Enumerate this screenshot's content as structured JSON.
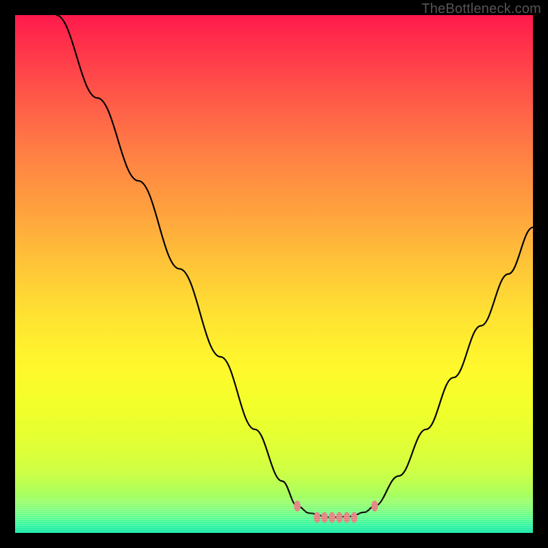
{
  "watermark": "TheBottleneck.com",
  "colors": {
    "curve_stroke": "#000000",
    "marker_stroke": "#e08080"
  },
  "chart_data": {
    "type": "line",
    "title": "",
    "xlabel": "",
    "ylabel": "",
    "xlim": [
      0,
      756
    ],
    "ylim": [
      1,
      0
    ],
    "grid": false,
    "legend": false,
    "series": [
      {
        "name": "left-branch",
        "x": [
          60,
          120,
          180,
          240,
          300,
          350,
          390,
          412
        ],
        "values": [
          0.0,
          0.16,
          0.32,
          0.49,
          0.66,
          0.8,
          0.9,
          0.948
        ]
      },
      {
        "name": "valley-floor",
        "x": [
          412,
          430,
          460,
          490,
          510,
          525
        ],
        "values": [
          0.948,
          0.962,
          0.97,
          0.968,
          0.96,
          0.948
        ]
      },
      {
        "name": "right-branch",
        "x": [
          525,
          560,
          600,
          640,
          680,
          720,
          756
        ],
        "values": [
          0.948,
          0.89,
          0.8,
          0.7,
          0.6,
          0.5,
          0.41
        ]
      }
    ],
    "markers": [
      {
        "name": "left-foot",
        "cx": 412,
        "cy_norm": 0.948,
        "r": 8
      },
      {
        "name": "floor-chain",
        "cx": 468,
        "cy_norm": 0.97,
        "r": 8,
        "count": 6,
        "spread": 54
      },
      {
        "name": "right-foot",
        "cx": 525,
        "cy_norm": 0.948,
        "r": 8
      }
    ]
  }
}
